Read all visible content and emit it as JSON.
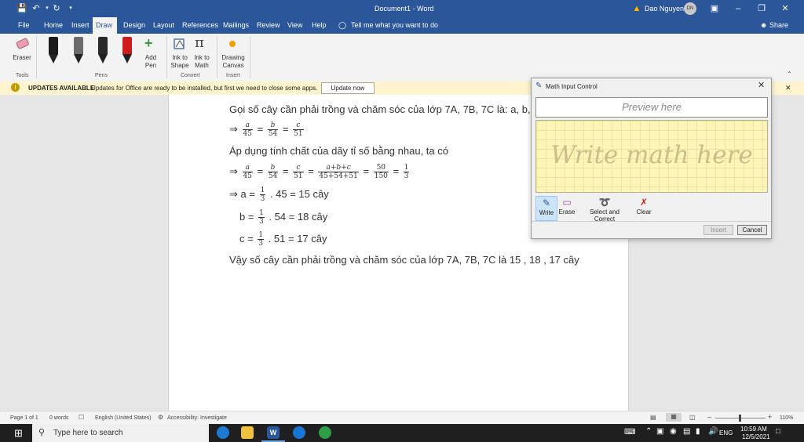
{
  "titlebar": {
    "document_title": "Document1 - Word",
    "warning_icon": "warning-icon",
    "user_name": "Dao Nguyen",
    "user_initials": "DN"
  },
  "tabs": [
    "File",
    "Home",
    "Insert",
    "Draw",
    "Design",
    "Layout",
    "References",
    "Mailings",
    "Review",
    "View",
    "Help"
  ],
  "active_tab": "Draw",
  "tell_me": "Tell me what you want to do",
  "share": "Share",
  "ribbon": {
    "eraser": "Eraser",
    "tools_group": "Tools",
    "pens_group": "Pens",
    "add_pen_line1": "Add",
    "add_pen_line2": "Pen",
    "ink_shape_line1": "Ink to",
    "ink_shape_line2": "Shape",
    "ink_math_line1": "Ink to",
    "ink_math_line2": "Math",
    "convert_group": "Convert",
    "drawing_canvas_line1": "Drawing",
    "drawing_canvas_line2": "Canvas",
    "insert_group": "Insert",
    "pen_colors": [
      "#1a1a1a",
      "#6b6b6b",
      "#2a2a2a",
      "#d11a1a"
    ]
  },
  "update_bar": {
    "title": "UPDATES AVAILABLE",
    "message": "Updates for Office are ready to be installed, but first we need to close some apps.",
    "button": "Update now"
  },
  "document": {
    "line1": "Gọi số cây cần phải trồng và chăm sóc của lớp 7A, 7B, 7C là: a, b, c",
    "line3": "Áp dụng tính chất của dãy tỉ số bằng nhau, ta có",
    "line8": "Vậy số cây cần phải trồng và chăm sóc của lớp 7A, 7B, 7C là 15 , 18 , 17 cây",
    "arrow": "⇒",
    "eq": "=",
    "var_a": "a",
    "var_b": "b",
    "var_c": "c",
    "den_45": "45",
    "den_54": "54",
    "den_51": "51",
    "sum_num": "a+b+c",
    "sum_den": "45+54+51",
    "num_50": "50",
    "den_150": "150",
    "one": "1",
    "three": "3",
    "a_prefix": "⇒ a =",
    "a_suffix": ". 45 = 15 cây",
    "b_prefix": "b =",
    "b_suffix": ". 54 = 18 cây",
    "c_prefix": "c =",
    "c_suffix": ". 51 = 17 cây"
  },
  "math_input": {
    "title": "Math Input Control",
    "preview_placeholder": "Preview here",
    "write_placeholder": "Write math here",
    "tools": [
      "Write",
      "Erase",
      "Select and Correct",
      "Clear"
    ],
    "insert": "Insert",
    "cancel": "Cancel"
  },
  "status": {
    "page": "Page 1 of 1",
    "words": "0 words",
    "language": "English (United States)",
    "accessibility": "Accessibility: Investigate",
    "zoom": "110%"
  },
  "taskbar": {
    "search_placeholder": "Type here to search",
    "lang": "ENG",
    "time": "10:59 AM",
    "date": "12/5/2021"
  }
}
